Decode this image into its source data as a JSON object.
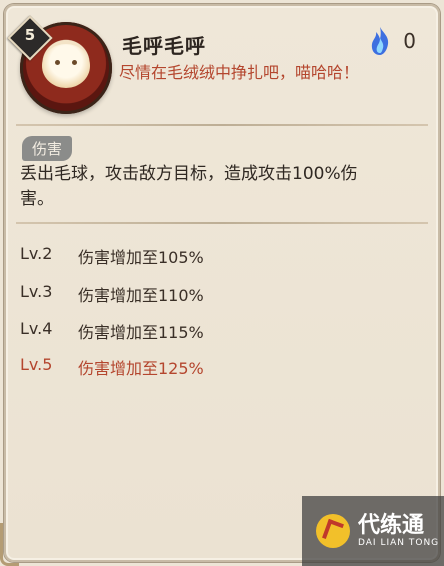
{
  "skill": {
    "level": "5",
    "name": "毛呼毛呼",
    "description": "尽情在毛绒绒中挣扎吧，喵哈哈！",
    "cost": "0",
    "cost_icon": "blue-ghost-flame-icon"
  },
  "tag": "伤害",
  "effect": "丢出毛球，攻击敌方目标，造成攻击100%伤害。",
  "upgrades": [
    {
      "lv": "Lv.2",
      "text": "伤害增加至105%"
    },
    {
      "lv": "Lv.3",
      "text": "伤害增加至110%"
    },
    {
      "lv": "Lv.4",
      "text": "伤害增加至115%"
    },
    {
      "lv": "Lv.5",
      "text": "伤害增加至125%"
    }
  ],
  "watermark": {
    "cn": "代练通",
    "en": "DAI LIAN TONG"
  },
  "colors": {
    "highlight": "#b4462e",
    "panel": "#ede5d6"
  }
}
